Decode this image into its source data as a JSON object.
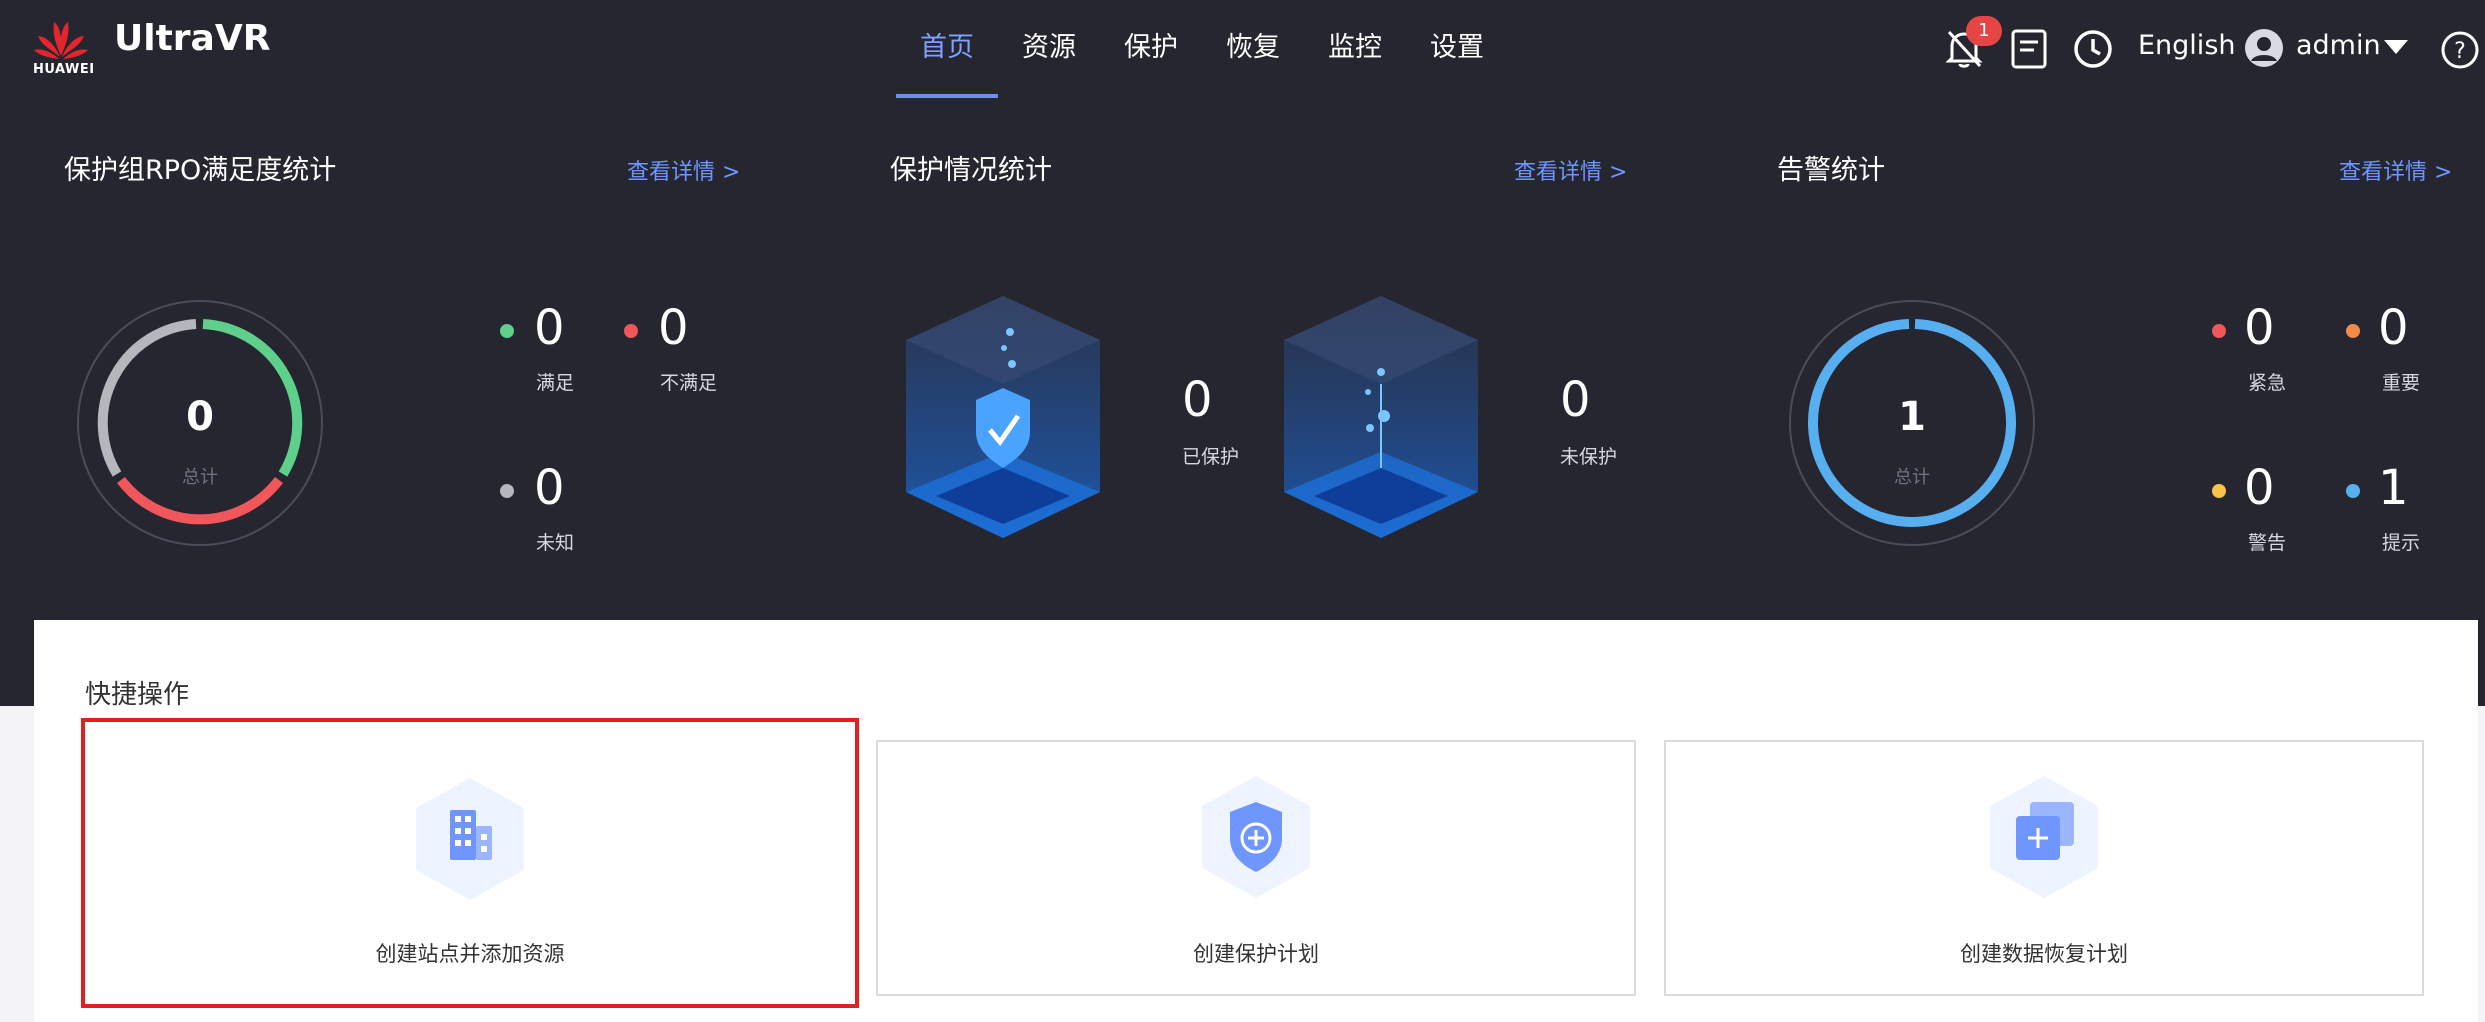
{
  "header": {
    "brand_logo_text": "HUAWEI",
    "app_title": "UltraVR",
    "nav": [
      {
        "label": "首页",
        "active": true
      },
      {
        "label": "资源"
      },
      {
        "label": "保护"
      },
      {
        "label": "恢复"
      },
      {
        "label": "监控"
      },
      {
        "label": "设置"
      }
    ],
    "alarm_badge": "1",
    "icons": [
      "bell-muted-icon",
      "notes-icon",
      "clock-icon",
      "avatar-icon",
      "caret-down-icon",
      "help-icon"
    ],
    "language": "English",
    "user": "admin"
  },
  "rpo": {
    "title": "保护组RPO满足度统计",
    "details": "查看详情 >",
    "total": "0",
    "total_label": "总计",
    "satisfied": {
      "value": "0",
      "label": "满足"
    },
    "unsatisfied": {
      "value": "0",
      "label": "不满足"
    },
    "unknown": {
      "value": "0",
      "label": "未知"
    }
  },
  "protection": {
    "title": "保护情况统计",
    "details": "查看详情 >",
    "protected": {
      "value": "0",
      "label": "已保护"
    },
    "unprotected": {
      "value": "0",
      "label": "未保护"
    }
  },
  "alarms": {
    "title": "告警统计",
    "details": "查看详情 >",
    "total": "1",
    "total_label": "总计",
    "critical": {
      "value": "0",
      "label": "紧急"
    },
    "major": {
      "value": "0",
      "label": "重要"
    },
    "warning": {
      "value": "0",
      "label": "警告"
    },
    "info": {
      "value": "1",
      "label": "提示"
    }
  },
  "quick_actions": {
    "title": "快捷操作",
    "items": [
      {
        "label": "创建站点并添加资源",
        "icon": "building-icon"
      },
      {
        "label": "创建保护计划",
        "icon": "shield-plus-icon"
      },
      {
        "label": "创建数据恢复计划",
        "icon": "copy-plus-icon"
      }
    ]
  },
  "colors": {
    "header_bg": "#25262f",
    "accent": "#6d8ff0",
    "green": "#5fd08b",
    "red": "#f0575b",
    "gray": "#b6b7bd",
    "orange": "#f28a48",
    "yellow": "#f6c548",
    "blue": "#58aff0",
    "highlight_border": "#e32020"
  }
}
